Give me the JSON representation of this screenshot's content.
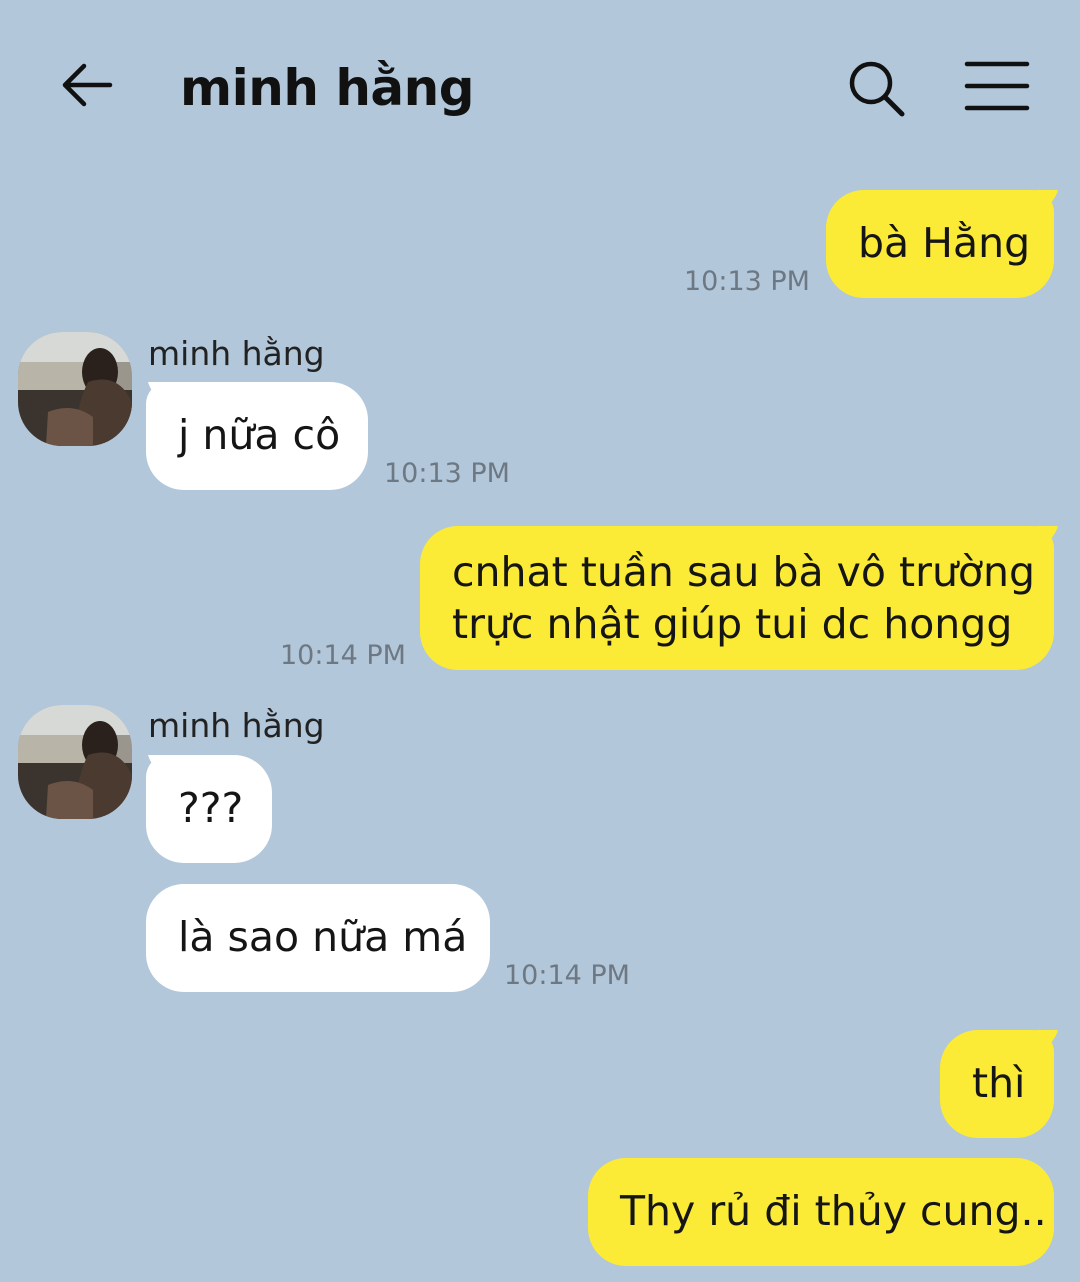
{
  "header": {
    "title": "minh hằng",
    "back_icon": "arrow-left-icon",
    "search_icon": "search-icon",
    "menu_icon": "hamburger-menu-icon"
  },
  "colors": {
    "background": "#b2c7da",
    "me_bubble": "#fbeb36",
    "them_bubble": "#ffffff",
    "timestamp": "#6d7883"
  },
  "messages": [
    {
      "from": "me",
      "text": "bà Hằng",
      "time": "10:13 PM"
    },
    {
      "from": "them",
      "sender": "minh hằng",
      "text": "j nữa cô",
      "time": "10:13 PM"
    },
    {
      "from": "me",
      "lines": [
        "cnhat tuần sau bà vô trường",
        "trực nhật giúp tui dc hongg"
      ],
      "time": "10:14 PM"
    },
    {
      "from": "them",
      "sender": "minh hằng",
      "text": "???"
    },
    {
      "from": "them",
      "text": "là sao nữa má",
      "time": "10:14 PM"
    },
    {
      "from": "me",
      "text": "thì"
    },
    {
      "from": "me",
      "text": "Thy rủ đi thủy cung.."
    }
  ]
}
